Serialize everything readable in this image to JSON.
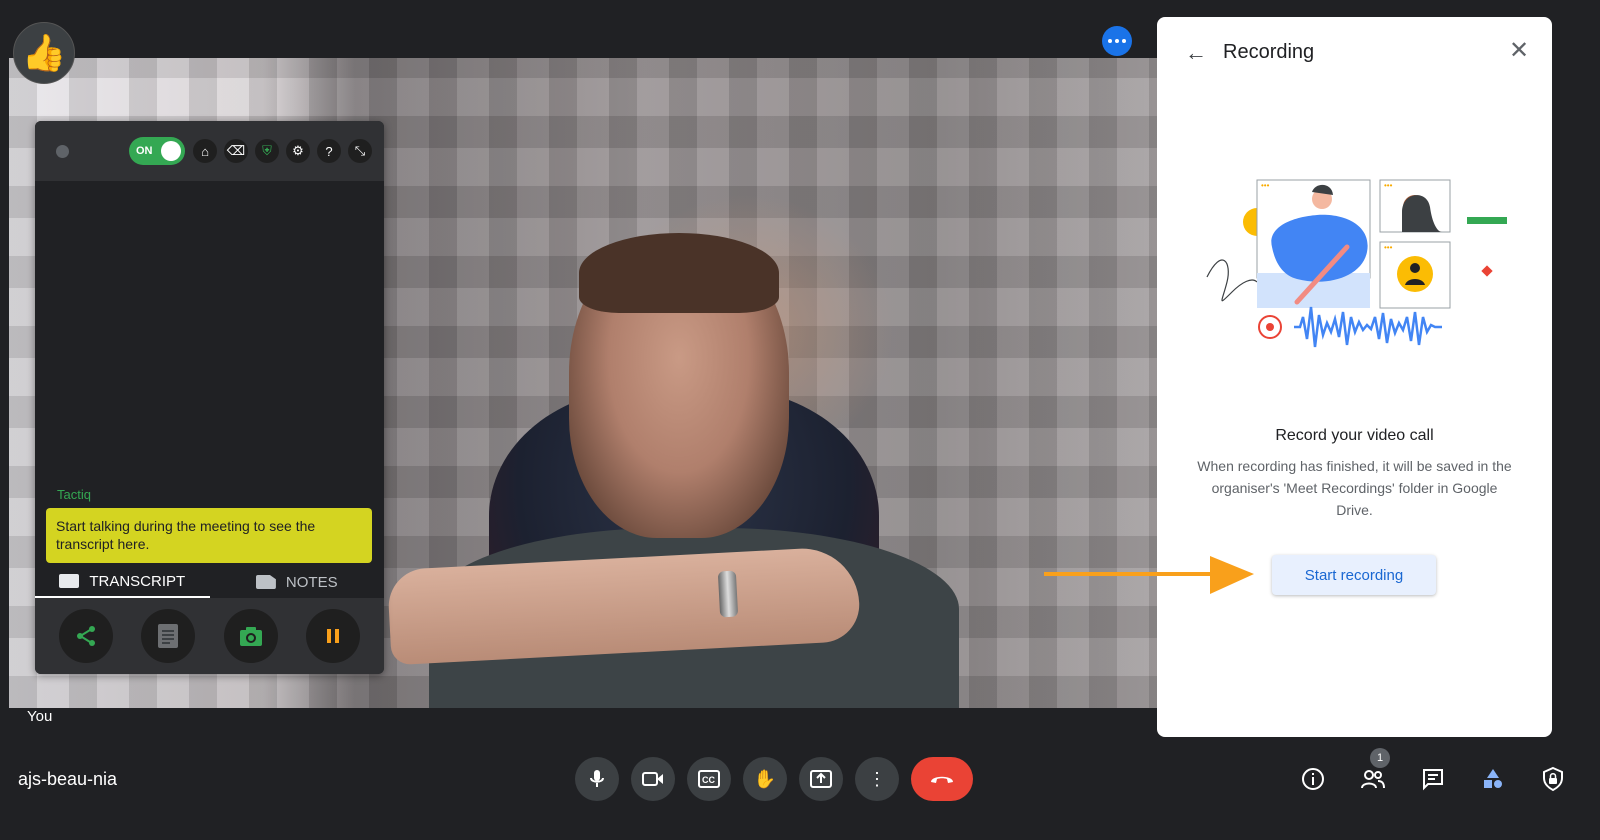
{
  "video": {
    "participant_label": "You"
  },
  "reactions": {
    "thumb_emoji": "👍"
  },
  "tactiq": {
    "toggle_label": "ON",
    "brand": "Tactiq",
    "message": "Start talking during the meeting to see the transcript here.",
    "tabs": [
      {
        "label": "TRANSCRIPT"
      },
      {
        "label": "NOTES"
      }
    ],
    "colors": {
      "brand": "#34a853",
      "message_bg": "#d4d421"
    }
  },
  "panel": {
    "title": "Recording",
    "heading": "Record your video call",
    "description": "When recording has finished, it will be saved in the organiser's 'Meet Recordings' folder in Google Drive.",
    "start_button": "Start recording"
  },
  "bottom_bar": {
    "meeting_code": "ajs-beau-nia",
    "people_count": "1"
  },
  "icons": {
    "colors": {
      "accent": "#1a73e8",
      "end_call": "#ea4335",
      "arrow": "#f9a01b"
    }
  }
}
